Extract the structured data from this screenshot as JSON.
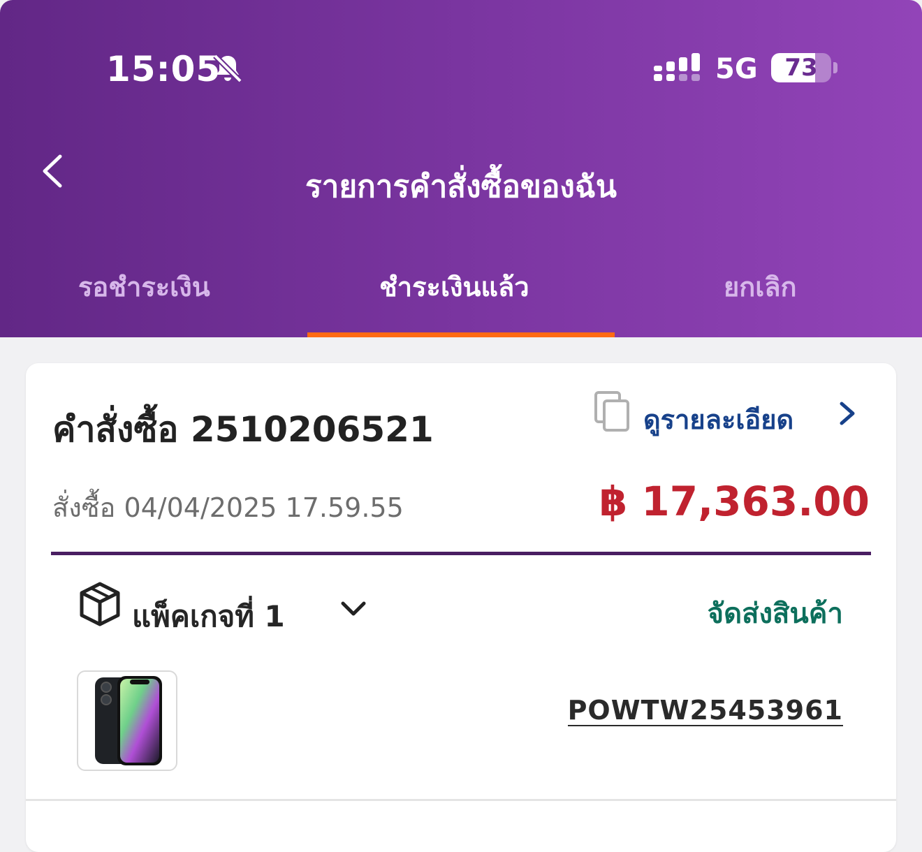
{
  "status_bar": {
    "time": "15:05",
    "network": "5G",
    "battery_level": 73
  },
  "header": {
    "title": "รายการคำสั่งซื้อของฉัน"
  },
  "tabs": [
    {
      "label": "รอชำระเงิน",
      "active": false
    },
    {
      "label": "ชำระเงินแล้ว",
      "active": true
    },
    {
      "label": "ยกเลิก",
      "active": false
    }
  ],
  "order": {
    "label": "คำสั่งซื้อ 2510206521",
    "details_link": "ดูรายละเอียด",
    "date": "สั่งซื้อ 04/04/2025 17.59.55",
    "total": "฿ 17,363.00",
    "package": {
      "label": "แพ็คเกจที่ 1",
      "status": "จัดส่งสินค้า",
      "tracking": "POWTW25453961"
    }
  },
  "colors": {
    "header_gradient_start": "#622786",
    "header_gradient_end": "#9244b8",
    "tab_indicator": "#ff6a13",
    "total_price": "#c0222f",
    "link": "#17418a",
    "ship_status": "#0d6f5c"
  },
  "icons": [
    "bell-slash-icon",
    "signal-icon",
    "battery-icon",
    "back-chevron-icon",
    "copy-icon",
    "chevron-right-icon",
    "package-box-icon",
    "chevron-down-icon"
  ]
}
